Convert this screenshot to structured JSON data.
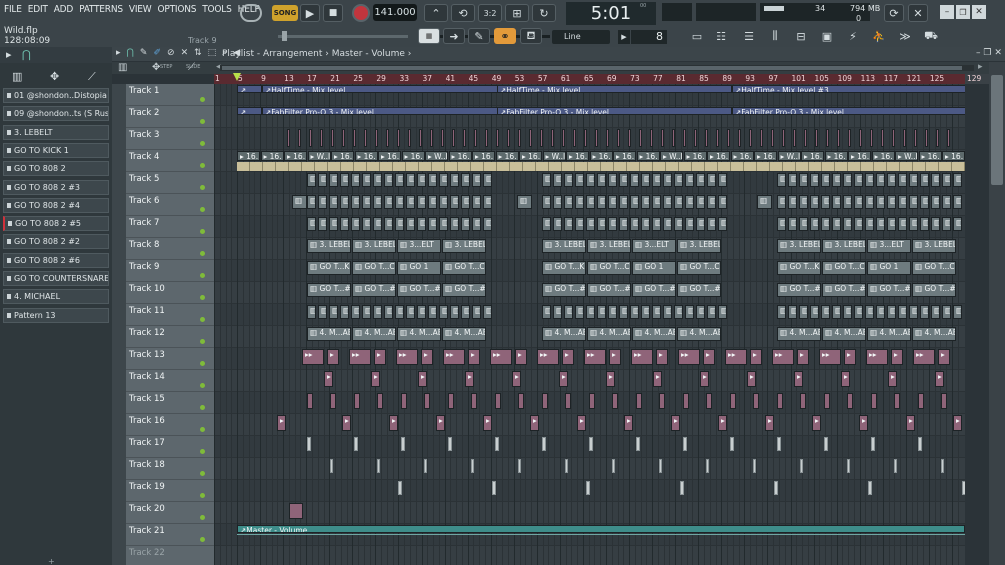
{
  "menu": [
    "FILE",
    "EDIT",
    "ADD",
    "PATTERNS",
    "VIEW",
    "OPTIONS",
    "TOOLS",
    "HELP"
  ],
  "project": {
    "name": "Wild.flp",
    "time": "128:08:09",
    "track_hint": "Track 9"
  },
  "transport": {
    "mode": "SONG",
    "tempo": "141.000",
    "time": "5:01",
    "time_sub": "00",
    "cpu": "34",
    "mem": "794 MB",
    "mem_sub": "0"
  },
  "snap": {
    "mode": "Line",
    "value": "8"
  },
  "playlist": {
    "title": "Playlist - Arrangement",
    "breadcrumb": "Master - Volume",
    "step": "STEP",
    "slide": "SLIDE"
  },
  "browser": {
    "items": [
      "01 @shondon..Distopia",
      "09 @shondon..ts (S Russ",
      "3. LEBELT",
      "GO TO KICK 1",
      "GO TO 808 2",
      "GO TO 808 2 #3",
      "GO TO 808 2 #4",
      "GO TO 808 2 #5",
      "GO TO 808 2 #2",
      "GO TO 808 2 #6",
      "GO TO COUNTERSNARE 2",
      "4. MICHAEL",
      "Pattern 13"
    ]
  },
  "ruler": [
    "1",
    "5",
    "9",
    "13",
    "17",
    "21",
    "25",
    "29",
    "33",
    "37",
    "41",
    "45",
    "49",
    "53",
    "57",
    "61",
    "65",
    "69",
    "73",
    "77",
    "81",
    "85",
    "89",
    "93",
    "97",
    "101",
    "105",
    "109",
    "113",
    "117",
    "121",
    "125",
    "129"
  ],
  "tracks": [
    "Track 1",
    "Track 2",
    "Track 3",
    "Track 4",
    "Track 5",
    "Track 6",
    "Track 7",
    "Track 8",
    "Track 9",
    "Track 10",
    "Track 11",
    "Track 12",
    "Track 13",
    "Track 14",
    "Track 15",
    "Track 16",
    "Track 17",
    "Track 18",
    "Track 19",
    "Track 20",
    "Track 21",
    "Track 22"
  ],
  "clips": {
    "t1": [
      "HalfTime - Mix level",
      "HalfTime - Mix level",
      "HalfTime - Mix level #3"
    ],
    "t2": [
      "FabFilter Pro-Q 3 - Mix level",
      "FabFilter Pro-Q 3 - Mix level",
      "FabFilter Pro-Q 3 - Mix level"
    ],
    "t4": "16. CAIRO",
    "t4_alt": "W..I C",
    "t8": [
      "3. LEBELT",
      "3. LEBELT",
      "3...ELT",
      "3. LEBELT"
    ],
    "t9": [
      "GO T...K 1",
      "GO T...CK 1",
      "GO 1",
      "GO T...CK 1"
    ],
    "t10": [
      "GO T...#2",
      "GO T...#3",
      "GO T...#4",
      "GO T...#6"
    ],
    "t12": "4. M...AEL",
    "t21": "Master - Volume"
  }
}
